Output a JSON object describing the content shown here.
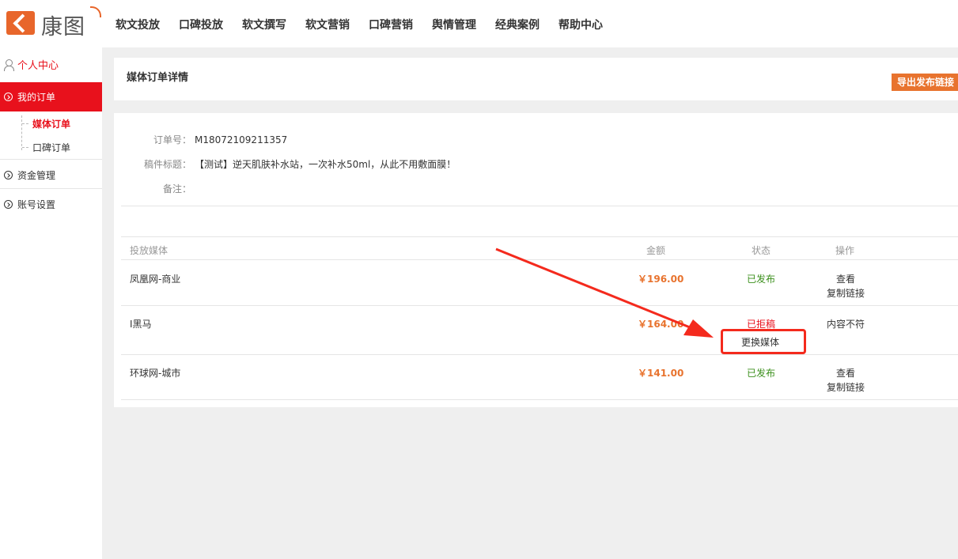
{
  "header": {
    "logo_text": "康图",
    "nav": [
      "软文投放",
      "口碑投放",
      "软文撰写",
      "软文营销",
      "口碑营销",
      "舆情管理",
      "经典案例",
      "帮助中心"
    ]
  },
  "sidebar": {
    "user_center": "个人中心",
    "my_orders": "我的订单",
    "sub_items": [
      "媒体订单",
      "口碑订单"
    ],
    "items": [
      "资金管理",
      "账号设置"
    ]
  },
  "page": {
    "title": "媒体订单详情",
    "export_button": "导出发布链接"
  },
  "order": {
    "order_no_label": "订单号：",
    "order_no": "M18072109211357",
    "title_label": "稿件标题：",
    "title": "【测试】逆天肌肤补水站，一次补水50ml，从此不用敷面膜！",
    "remark_label": "备注："
  },
  "table": {
    "headers": {
      "media": "投放媒体",
      "amount": "金额",
      "status": "状态",
      "action": "操作"
    },
    "rows": [
      {
        "media": "凤凰网-商业",
        "amount": "￥196.00",
        "status": "已发布",
        "action1": "查看",
        "action2": "复制链接"
      },
      {
        "media": "I黑马",
        "amount": "￥164.00",
        "status": "已拒稿",
        "status_action": "更换媒体",
        "action1": "内容不符"
      },
      {
        "media": "环球网-城市",
        "amount": "￥141.00",
        "status": "已发布",
        "action1": "查看",
        "action2": "复制链接"
      }
    ]
  },
  "colors": {
    "brand_red": "#e8111c",
    "accent_orange": "#e8732e",
    "published_green": "#3b8f1c",
    "annotation_red": "#f42a1d"
  }
}
